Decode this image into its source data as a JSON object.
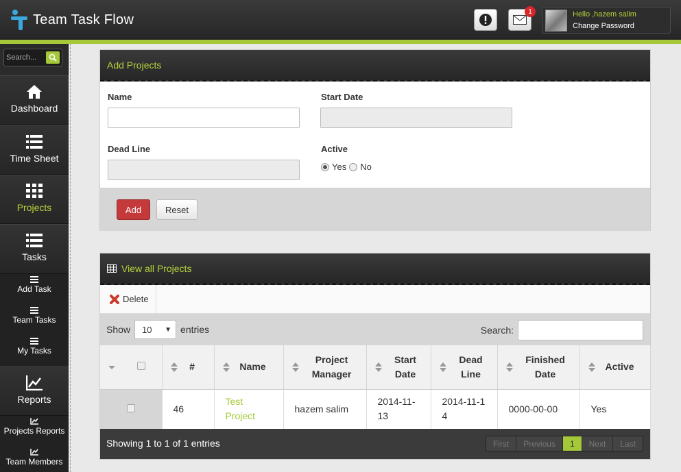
{
  "app": {
    "title": "Team Task Flow"
  },
  "header": {
    "mail_badge": "1",
    "user_greeting": "Hello ,hazem salim",
    "change_password": "Change Password"
  },
  "sidebar": {
    "search_placeholder": "Search...",
    "items": [
      {
        "label": "Dashboard",
        "icon": "home-icon"
      },
      {
        "label": "Time Sheet",
        "icon": "list-icon"
      },
      {
        "label": "Projects",
        "icon": "grid-icon",
        "active": true
      },
      {
        "label": "Tasks",
        "icon": "list-icon"
      },
      {
        "label": "Reports",
        "icon": "chart-icon"
      }
    ],
    "task_subitems": [
      "Add Task",
      "Team Tasks",
      "My Tasks"
    ],
    "report_subitems": [
      "Projects Reports",
      "Team Members"
    ]
  },
  "add_form": {
    "title": "Add Projects",
    "name_label": "Name",
    "start_label": "Start Date",
    "deadline_label": "Dead Line",
    "active_label": "Active",
    "yes": "Yes",
    "no": "No",
    "add_button": "Add",
    "reset_button": "Reset"
  },
  "projects_table": {
    "title": "View all Projects",
    "delete_label": "Delete",
    "show_label": "Show",
    "entries_value": "10",
    "entries_label": "entries",
    "search_label": "Search:",
    "columns": [
      "#",
      "Name",
      "Project Manager",
      "Start Date",
      "Dead Line",
      "Finished Date",
      "Active"
    ],
    "rows": [
      {
        "id": "46",
        "name": "Test Project",
        "manager": "hazem salim",
        "start": "2014-11-13",
        "deadline": "2014-11-14",
        "finished": "0000-00-00",
        "active": "Yes"
      }
    ],
    "info": "Showing 1 to 1 of 1 entries",
    "pager": [
      "First",
      "Previous",
      "1",
      "Next",
      "Last"
    ]
  },
  "colors": {
    "accent": "#a5c83a",
    "danger": "#c43a3a",
    "dark": "#2b2b2b"
  }
}
